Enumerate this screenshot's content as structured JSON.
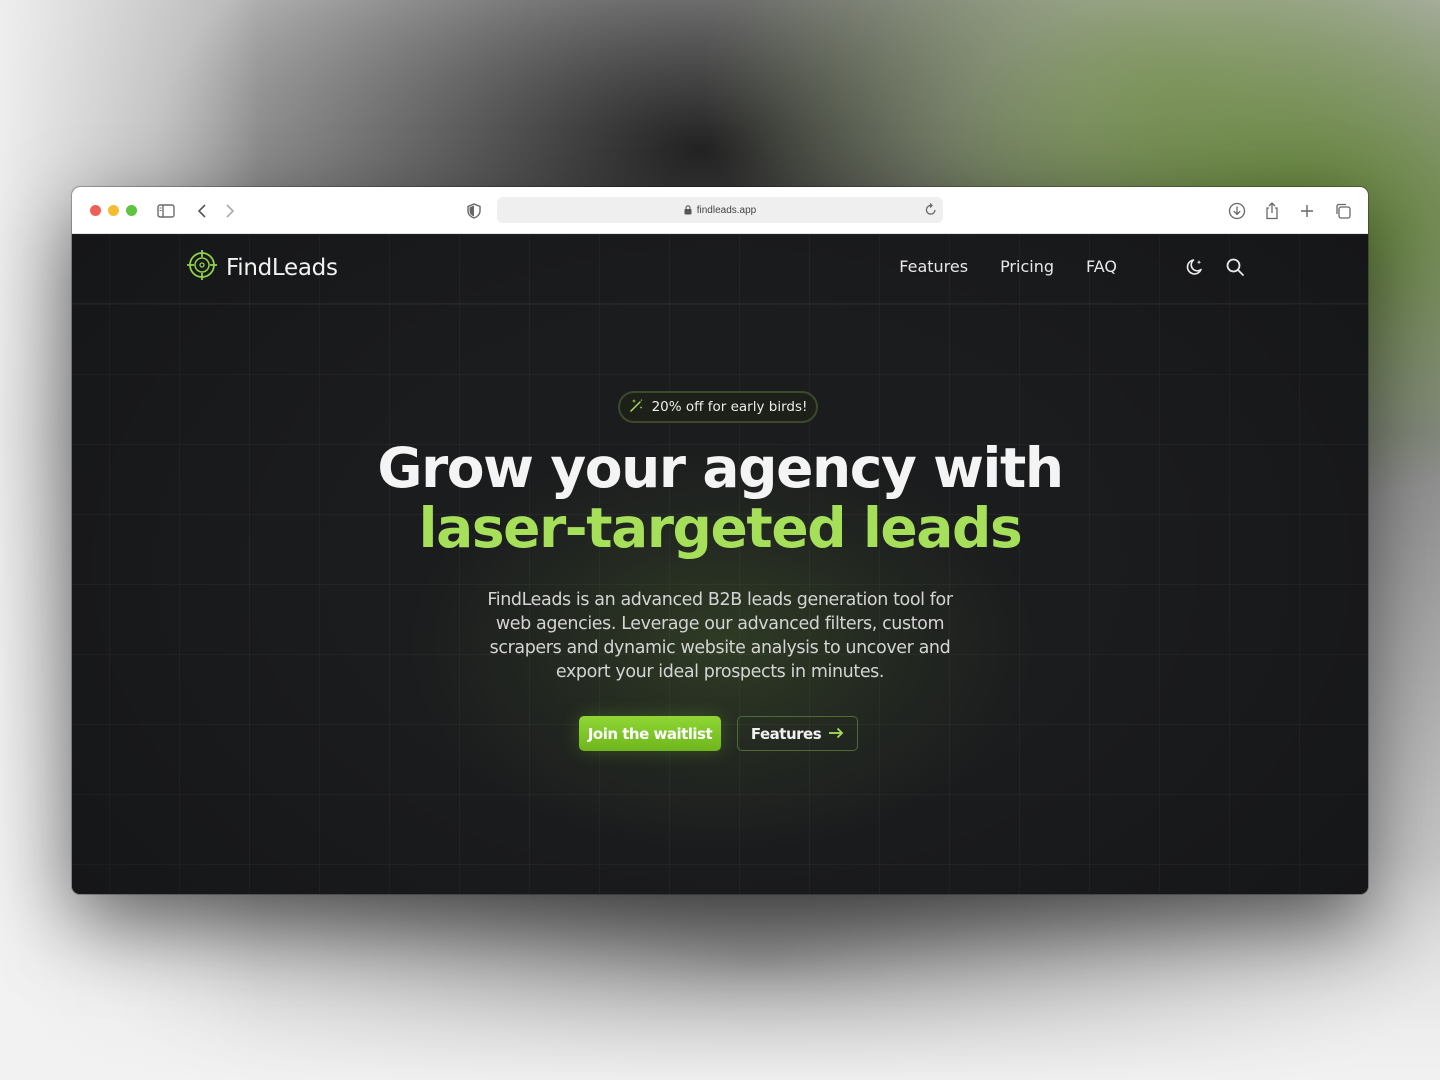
{
  "browser": {
    "url": "findleads.app"
  },
  "nav": {
    "logo_text": "FindLeads",
    "links": [
      "Features",
      "Pricing",
      "FAQ"
    ]
  },
  "hero": {
    "badge": "20% off for early birds!",
    "headline_line1": "Grow your agency with",
    "headline_line2": "laser-targeted leads",
    "description": "FindLeads is an advanced B2B leads generation tool for web agencies. Leverage our advanced filters, custom scrapers and dynamic website analysis to uncover and export your ideal prospects in minutes.",
    "primary_button": "Join the waitlist",
    "secondary_button": "Features"
  },
  "colors": {
    "accent": "#a6e05a",
    "button_green": "#7cc428",
    "page_background": "#1b1c1e"
  },
  "icons": [
    "sidebar-icon",
    "back-icon",
    "forward-icon",
    "shield-icon",
    "lock-icon",
    "reload-icon",
    "download-icon",
    "share-icon",
    "new-tab-icon",
    "tabs-overview-icon",
    "target-logo-icon",
    "moon-icon",
    "search-icon",
    "magic-wand-icon",
    "arrow-right-icon"
  ]
}
